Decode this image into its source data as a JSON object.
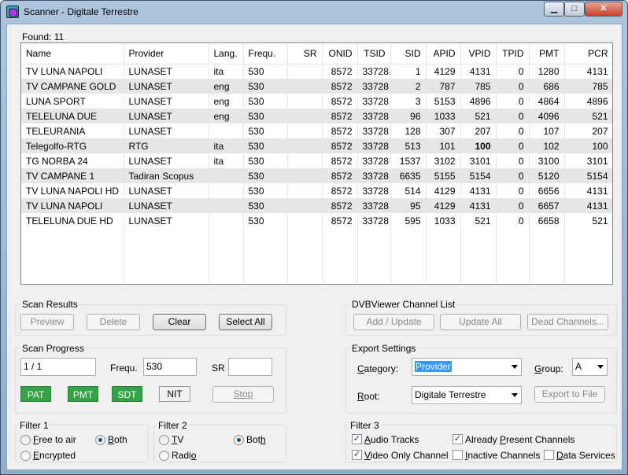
{
  "window": {
    "title": "Scanner - Digitale Terrestre",
    "min": "▁",
    "max": "□",
    "close": "✕"
  },
  "found": {
    "label": "Found:",
    "count": "11"
  },
  "table": {
    "columns": [
      "Name",
      "Provider",
      "Lang.",
      "Frequ.",
      "SR",
      "ONID",
      "TSID",
      "SID",
      "APID",
      "VPID",
      "TPID",
      "PMT",
      "PCR"
    ],
    "rows": [
      [
        "TV LUNA NAPOLI",
        "LUNASET",
        "ita",
        "530",
        "",
        "8572",
        "33728",
        "1",
        "4129",
        "4131",
        "0",
        "1280",
        "4131"
      ],
      [
        "TV CAMPANE GOLD",
        "LUNASET",
        "eng",
        "530",
        "",
        "8572",
        "33728",
        "2",
        "787",
        "785",
        "0",
        "686",
        "785"
      ],
      [
        "LUNA SPORT",
        "LUNASET",
        "eng",
        "530",
        "",
        "8572",
        "33728",
        "3",
        "5153",
        "4896",
        "0",
        "4864",
        "4896"
      ],
      [
        "TELELUNA DUE",
        "LUNASET",
        "eng",
        "530",
        "",
        "8572",
        "33728",
        "96",
        "1033",
        "521",
        "0",
        "4096",
        "521"
      ],
      [
        "TELEURANIA",
        "LUNASET",
        "",
        "530",
        "",
        "8572",
        "33728",
        "128",
        "307",
        "207",
        "0",
        "107",
        "207"
      ],
      [
        "Telegolfo-RTG",
        "RTG",
        "ita",
        "530",
        "",
        "8572",
        "33728",
        "513",
        "101",
        "100",
        "0",
        "102",
        "100"
      ],
      [
        "TG NORBA 24",
        "LUNASET",
        "ita",
        "530",
        "",
        "8572",
        "33728",
        "1537",
        "3102",
        "3101",
        "0",
        "3100",
        "3101"
      ],
      [
        "TV CAMPANE 1",
        "Tadiran Scopus",
        "",
        "530",
        "",
        "8572",
        "33728",
        "6635",
        "5155",
        "5154",
        "0",
        "5120",
        "5154"
      ],
      [
        "TV LUNA NAPOLI HD",
        "LUNASET",
        "",
        "530",
        "",
        "8572",
        "33728",
        "514",
        "4129",
        "4131",
        "0",
        "6656",
        "4131"
      ],
      [
        "TV LUNA NAPOLI",
        "LUNASET",
        "",
        "530",
        "",
        "8572",
        "33728",
        "95",
        "4129",
        "4131",
        "0",
        "6657",
        "4131"
      ],
      [
        "TELELUNA DUE HD",
        "LUNASET",
        "",
        "530",
        "",
        "8572",
        "33728",
        "595",
        "1033",
        "521",
        "0",
        "6658",
        "521"
      ]
    ]
  },
  "scan_results": {
    "title": "Scan Results",
    "preview": "Preview",
    "delete": "Delete",
    "clear": "Clear",
    "select_all": "Select All"
  },
  "channel_list": {
    "title": "DVBViewer Channel List",
    "add_update": "Add / Update",
    "update_all": "Update All",
    "dead_channels": "Dead Channels..."
  },
  "scan_progress": {
    "title": "Scan Progress",
    "progress": "1 / 1",
    "frequ_label": "Frequ.",
    "frequ_value": "530",
    "sr_label": "SR",
    "sr_value": "",
    "pat": "PAT",
    "pmt": "PMT",
    "sdt": "SDT",
    "nit": "NIT",
    "stop": "Stop"
  },
  "export": {
    "title": "Export Settings",
    "category_label": "Category:",
    "category_value": "Provider",
    "group_label": "Group:",
    "group_value": "A",
    "root_label": "Root:",
    "root_value": "Digitale Terrestre",
    "export_button": "Export to File"
  },
  "filter1": {
    "title": "Filter 1",
    "free_to_air": "Free to air",
    "both": "Both",
    "encrypted": "Encrypted"
  },
  "filter2": {
    "title": "Filter 2",
    "tv": "TV",
    "both": "Both",
    "radio": "Radio"
  },
  "filter3": {
    "title": "Filter 3",
    "audio_tracks": "Audio Tracks",
    "already_present": "Already Present Channels",
    "video_only": "Video Only Channel",
    "inactive": "Inactive Channels",
    "data_services": "Data Services"
  },
  "colors": {
    "status_green": "#31a444",
    "selection": "#3399ff"
  }
}
